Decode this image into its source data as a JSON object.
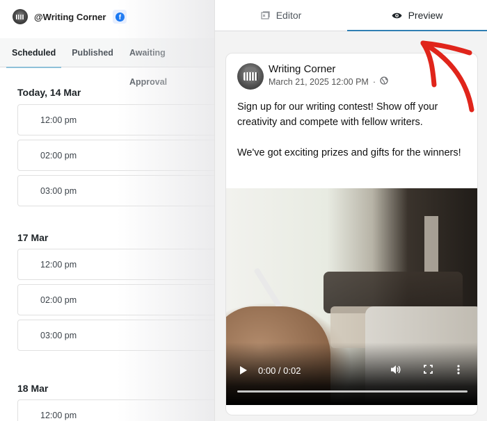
{
  "account": {
    "handle": "@Writing Corner",
    "network_icon": "facebook-icon",
    "network_color": "#1877f2"
  },
  "left_tabs": [
    {
      "label": "Scheduled",
      "active": true
    },
    {
      "label": "Published",
      "active": false
    },
    {
      "label": "Awaiting Approval",
      "active": false
    }
  ],
  "schedule": [
    {
      "day": "Today, 14 Mar",
      "slots": [
        "12:00 pm",
        "02:00 pm",
        "03:00 pm"
      ]
    },
    {
      "day": "17 Mar",
      "slots": [
        "12:00 pm",
        "02:00 pm",
        "03:00 pm"
      ]
    },
    {
      "day": "18 Mar",
      "slots": [
        "12:00 pm"
      ]
    }
  ],
  "right_tabs": {
    "editor": {
      "label": "Editor",
      "icon": "editor-icon",
      "active": false
    },
    "preview": {
      "label": "Preview",
      "icon": "eye-icon",
      "active": true
    }
  },
  "post": {
    "page_name": "Writing Corner",
    "date": "March 21, 2025 12:00 PM",
    "separator": "·",
    "privacy_icon": "globe-icon",
    "paragraphs": [
      "Sign up for our writing contest! Show off your creativity and compete with fellow writers.",
      "We've got exciting prizes and gifts for the winners!"
    ],
    "video": {
      "time": "0:00 / 0:02",
      "progress": 0
    }
  },
  "annotation": {
    "type": "hand-drawn-arrow",
    "color": "#e0251b",
    "points_to": "Preview tab"
  },
  "colors": {
    "active_tab_underline": "#2f7fb3",
    "left_tab_underline": "#8ec0d8"
  }
}
